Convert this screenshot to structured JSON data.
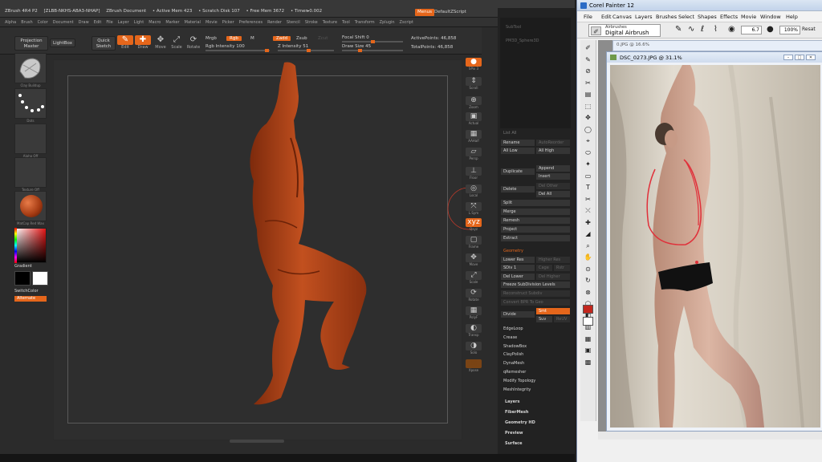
{
  "zbrush": {
    "title_parts": [
      "ZBrush 4R4 P2",
      "[ZLBB-NKHS-ABA3-NHAP]",
      "ZBrush Document",
      "• Active Mem 423",
      "• Scratch Disk 107",
      "• Free Mem 3672",
      "• Timer▸0.002"
    ],
    "menus_button": "Menus",
    "default_script": "DefaultZScript",
    "window_controls": "– □ ✕",
    "menubar": [
      "Alpha",
      "Brush",
      "Color",
      "Document",
      "Draw",
      "Edit",
      "File",
      "Layer",
      "Light",
      "Macro",
      "Marker",
      "Material",
      "Movie",
      "Picker",
      "Preferences",
      "Render",
      "Stencil",
      "Stroke",
      "Texture",
      "Tool",
      "Transform",
      "Zplugin",
      "Zscript"
    ],
    "shelf": {
      "projection_master": "Projection Master",
      "lightbox": "LightBox",
      "quick_sketch": "Quick Sketch",
      "edit": "Edit",
      "draw": "Draw",
      "move": "Move",
      "scale": "Scale",
      "rotate": "Rotate",
      "mrgb": "Mrgb",
      "rgb": "Rgb",
      "m": "M",
      "zadd": "Zadd",
      "zsub": "Zsub",
      "zcut": "Zcut",
      "rgb_intensity": "Rgb Intensity 100",
      "z_intensity": "Z Intensity 51",
      "focal_shift": "Focal Shift 0",
      "draw_size": "Draw Size 45",
      "active_points": "ActivePoints: 46,858",
      "total_points": "TotalPoints: 46,858"
    },
    "left": {
      "thumb_labels": [
        "Clay Buildup",
        "Dots",
        "Alpha Off",
        "Texture Off",
        "MatCap Red Wax"
      ],
      "gradient": "Gradient",
      "switch_color": "SwitchColor",
      "alternate": "Alternate"
    },
    "right_toolbar": [
      "SPix 3",
      "Scroll",
      "Zoom",
      "Actual",
      "AAHalf",
      "Persp",
      "Floor",
      "Local",
      "L.Sym",
      "Qxyz",
      "Frame",
      "Move",
      "Scale",
      "Rotate",
      "PolyF",
      "Transp",
      "Solo",
      "Xpose"
    ],
    "subtool": {
      "list_dim": [
        "SubTool",
        "PM3D_Sphere3D",
        "",
        "",
        "",
        "",
        "",
        ""
      ],
      "list_all": "List All",
      "rename": "Rename",
      "auto_reorder": "AutoReorder",
      "all_low": "All Low",
      "all_high": "All High",
      "duplicate": "Duplicate",
      "append": "Append",
      "insert": "Insert",
      "delete": "Delete",
      "del_other": "Del Other",
      "del_all": "Del All",
      "split": "Split",
      "merge": "Merge",
      "remesh": "Remesh",
      "project": "Project",
      "extract": "Extract"
    },
    "geometry": {
      "header": "Geometry",
      "lower_res": "Lower Res",
      "higher_res": "Higher Res",
      "sdiv": "SDiv 1",
      "cage": "Cage",
      "rstr": "Rstr",
      "del_lower": "Del Lower",
      "del_higher": "Del Higher",
      "freeze": "Freeze SubDivision Levels",
      "reconstruct": "Reconstruct Subdiv",
      "convert_bpr": "Convert BPR To Geo",
      "divide": "Divide",
      "smt": "Smt",
      "suv": "Suv",
      "reuv": "ReUV",
      "items": [
        "EdgeLoop",
        "Crease",
        "ShadowBox",
        "ClayPolish",
        "DynaMesh",
        "qRemesher",
        "Modify Topology",
        "MeshIntegrity"
      ]
    },
    "palettes": [
      "Layers",
      "FiberMesh",
      "Geometry HD",
      "Preview",
      "Surface"
    ]
  },
  "painter": {
    "title": "Corel Painter 12",
    "menus": [
      "File",
      "Edit",
      "Canvas",
      "Layers",
      "Brushes",
      "Select",
      "Shapes",
      "Effects",
      "Movie",
      "Window",
      "Help"
    ],
    "brush_category": "Airbrushes",
    "brush_variant": "Digital Airbrush",
    "size_value": "6.7",
    "opacity_value": "100%",
    "texture_label": "Resat",
    "back_doc_title": "0.JPG @ 16.6%",
    "doc_title": "DSC_0273.JPG @ 31.1%",
    "doc_buttons": [
      "–",
      "□",
      "✕"
    ]
  },
  "colors": {
    "zbrush_accent": "#e5661b",
    "clay": "#b7441d",
    "overlay_line": "#e0303a"
  }
}
